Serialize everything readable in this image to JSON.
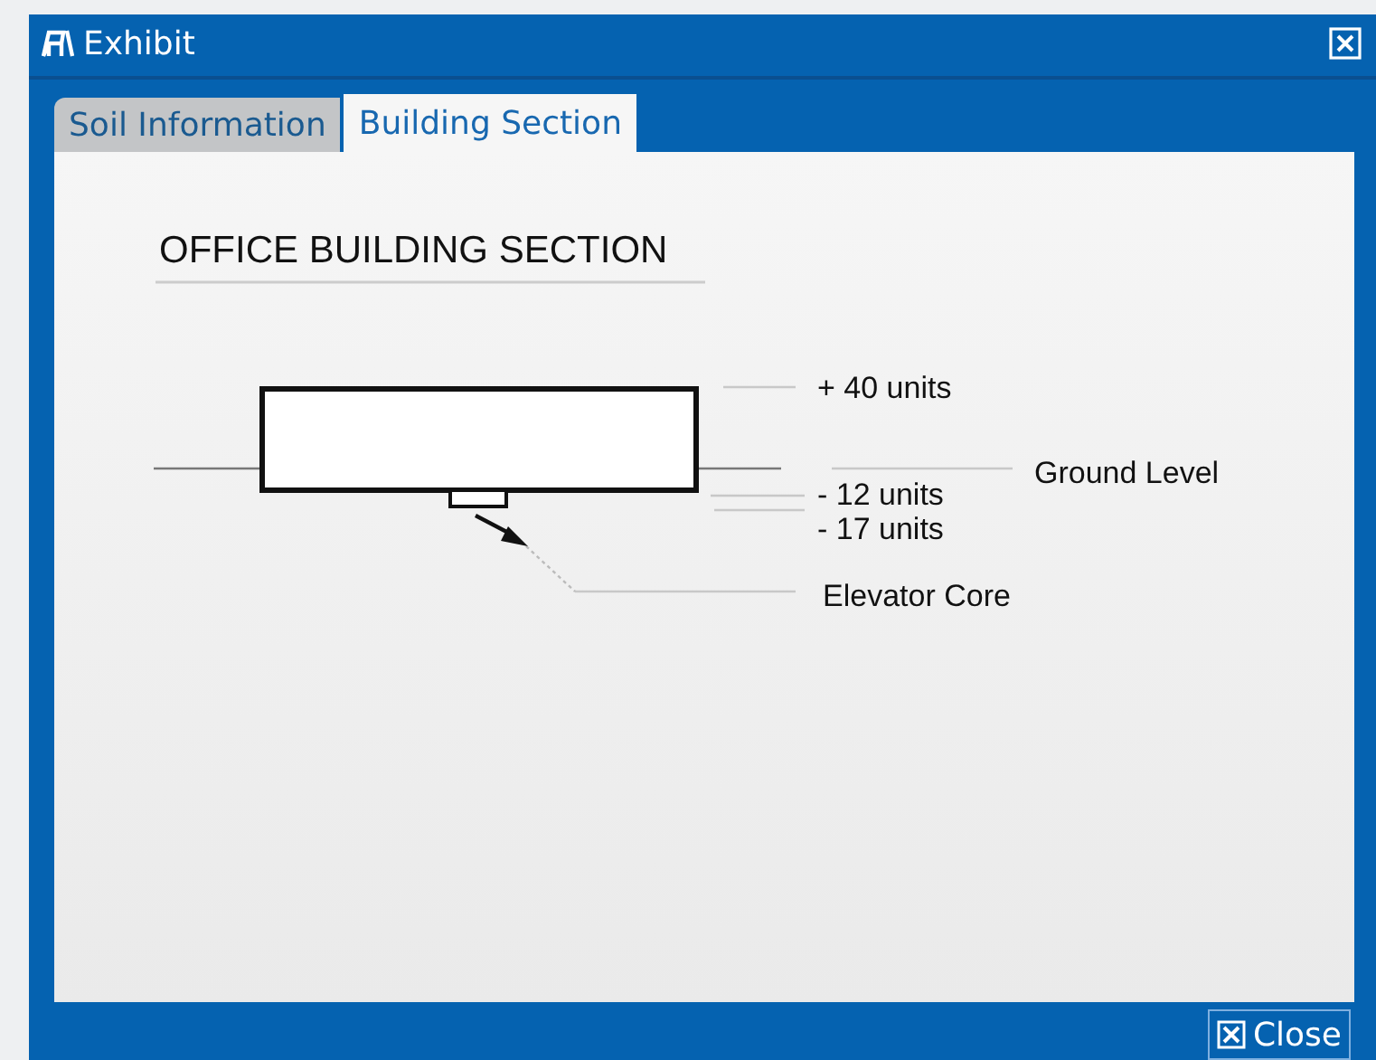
{
  "window": {
    "title": "Exhibit"
  },
  "tabs": [
    {
      "label": "Soil Information",
      "selected": false
    },
    {
      "label": "Building Section",
      "selected": true
    }
  ],
  "section": {
    "title": "OFFICE BUILDING SECTION",
    "labels": [
      {
        "kind": "top",
        "text": "+ 40 units"
      },
      {
        "kind": "ground",
        "text": "Ground Level"
      },
      {
        "kind": "base",
        "text": "- 12 units"
      },
      {
        "kind": "core-base",
        "text": "- 17 units"
      },
      {
        "kind": "core",
        "text": "Elevator Core"
      }
    ]
  },
  "buttons": [
    {
      "label": "Close"
    }
  ]
}
